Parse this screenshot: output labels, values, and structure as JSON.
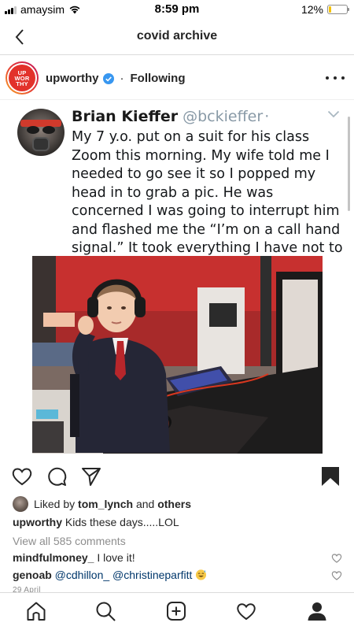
{
  "status_bar": {
    "carrier": "amaysim",
    "time": "8:59 pm",
    "battery": "12%",
    "battery_level": 0.12
  },
  "nav": {
    "title": "covid archive",
    "back_icon": "chevron-left-icon"
  },
  "post": {
    "account": {
      "username": "upworthy",
      "avatar_text": [
        "UP",
        "WOR",
        "THY"
      ],
      "verified": true,
      "follow_state": "Following",
      "separator": "·"
    },
    "tweet": {
      "name": "Brian Kieffer",
      "handle": "@bckieffer",
      "handle_suffix": "·",
      "text": "My 7 y.o. put on a suit for his class Zoom this morning. My wife told me I needed to go see it so I popped my head in to grab a pic. He was concerned I was going to interrupt him and flashed me the “I’m on a call hand signal.” It took everything I have not to bust out laughing."
    },
    "actions": [
      "heart-icon",
      "comment-icon",
      "share-icon",
      "bookmark-icon"
    ],
    "likes": {
      "prefix": "Liked by",
      "user": "tom_lynch",
      "conjunction": "and",
      "others": "others"
    },
    "caption": {
      "username": "upworthy",
      "text": "Kids these days.....LOL"
    },
    "view_all_comments": "View all 585 comments",
    "comments": [
      {
        "username": "mindfulmoney_",
        "text": "I love it!"
      },
      {
        "username": "genoab",
        "mention1": "@cdhillon_",
        "mention2": "@christineparfitt",
        "emoji": "sweat-smile-emoji"
      }
    ],
    "date": "29 April"
  },
  "tab_bar": {
    "tabs": [
      "home-icon",
      "search-icon",
      "new-post-icon",
      "activity-heart-icon",
      "profile-icon"
    ]
  },
  "colors": {
    "ig_text": "#262626",
    "muted": "#8e8e8e",
    "upworthy_red": "#e2322b",
    "verified_blue": "#3897f0",
    "mention": "#00376b"
  }
}
